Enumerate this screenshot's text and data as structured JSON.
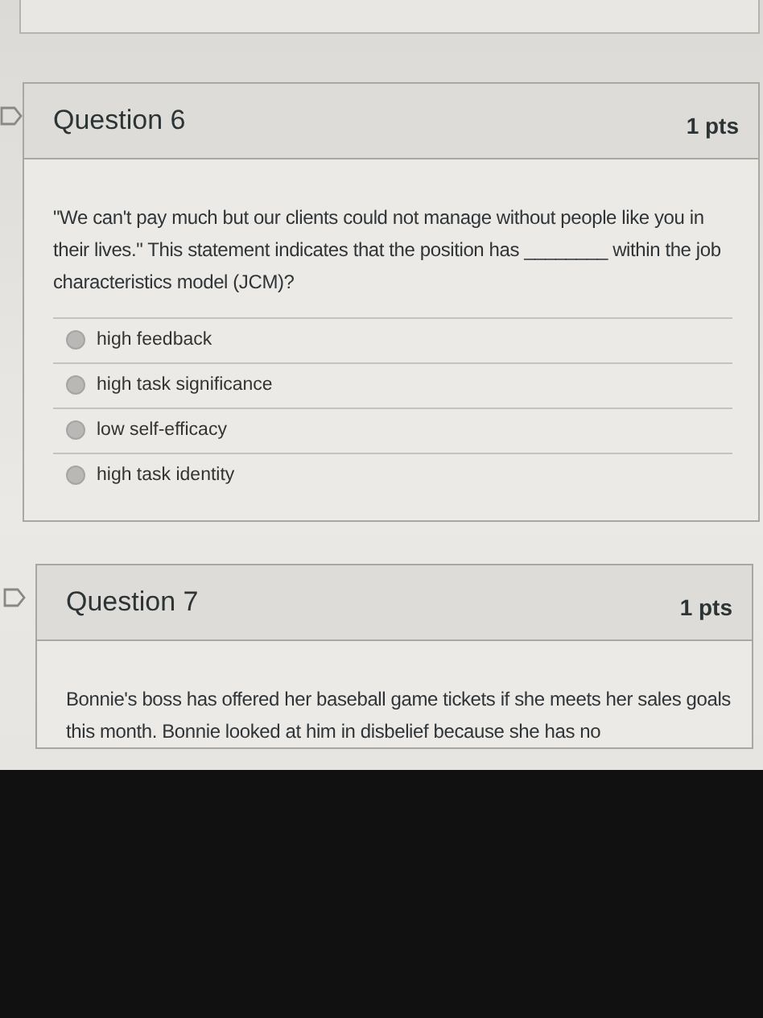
{
  "questions": [
    {
      "title": "Question 6",
      "points": "1 pts",
      "text": "\"We can't pay much but our clients could not manage without people like you in their lives.\" This statement indicates that the position has ________ within the job characteristics model (JCM)?",
      "answers": [
        {
          "label": "high feedback",
          "selected": false
        },
        {
          "label": "high task significance",
          "selected": false
        },
        {
          "label": "low self-efficacy",
          "selected": false
        },
        {
          "label": "high task identity",
          "selected": false
        }
      ]
    },
    {
      "title": "Question 7",
      "points": "1 pts",
      "text": "Bonnie's boss has offered her baseball game tickets if she meets her sales goals this month. Bonnie looked at him in disbelief because she has no"
    }
  ]
}
